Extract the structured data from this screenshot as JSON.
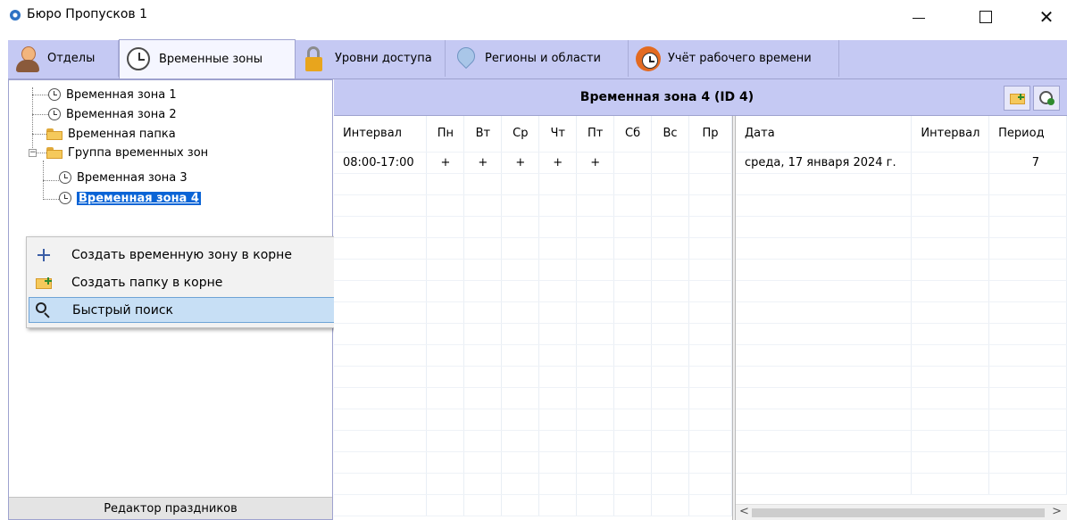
{
  "window": {
    "title": "Бюро Пропусков 1",
    "minimize": "",
    "maximize": "",
    "close": "✕"
  },
  "tabs": [
    {
      "label": "Отделы",
      "icon": "person-icon"
    },
    {
      "label": "Временные зоны",
      "icon": "clock-icon",
      "active": true
    },
    {
      "label": "Уровни доступа",
      "icon": "lock-icon"
    },
    {
      "label": "Регионы и области",
      "icon": "map-pin-icon"
    },
    {
      "label": "Учёт рабочего времени",
      "icon": "alarm-clock-icon"
    }
  ],
  "tree": {
    "items": [
      {
        "label": "Временная зона 1",
        "type": "zone"
      },
      {
        "label": "Временная зона 2",
        "type": "zone"
      },
      {
        "label": "Временная папка",
        "type": "folder"
      },
      {
        "label": "Группа временных зон",
        "type": "folder",
        "expander": "−"
      },
      {
        "label": "Временная зона 3",
        "type": "zone"
      },
      {
        "label": "Временная зона 4",
        "type": "zone",
        "selected": true
      }
    ]
  },
  "context_menu": {
    "items": [
      {
        "label": "Создать временную зону в корне",
        "icon": "plus-icon"
      },
      {
        "label": "Создать папку в корне",
        "icon": "folder-add-icon"
      },
      {
        "label": "Быстрый поиск",
        "icon": "search-icon",
        "highlighted": true
      }
    ]
  },
  "holiday_editor_button": "Редактор праздников",
  "zone_panel": {
    "title": "Временная зона 4 (ID 4)",
    "intervals": {
      "columns": [
        "Интервал",
        "Пн",
        "Вт",
        "Ср",
        "Чт",
        "Пт",
        "Сб",
        "Вс",
        "Пр"
      ],
      "rows": [
        [
          "08:00-17:00",
          "+",
          "+",
          "+",
          "+",
          "+",
          "",
          "",
          ""
        ]
      ]
    },
    "dates": {
      "columns": [
        "Дата",
        "Интервал",
        "Период"
      ],
      "rows": [
        [
          "среда, 17 января 2024 г.",
          "",
          "7"
        ]
      ]
    },
    "scroll_left": "<",
    "scroll_right": ">"
  }
}
